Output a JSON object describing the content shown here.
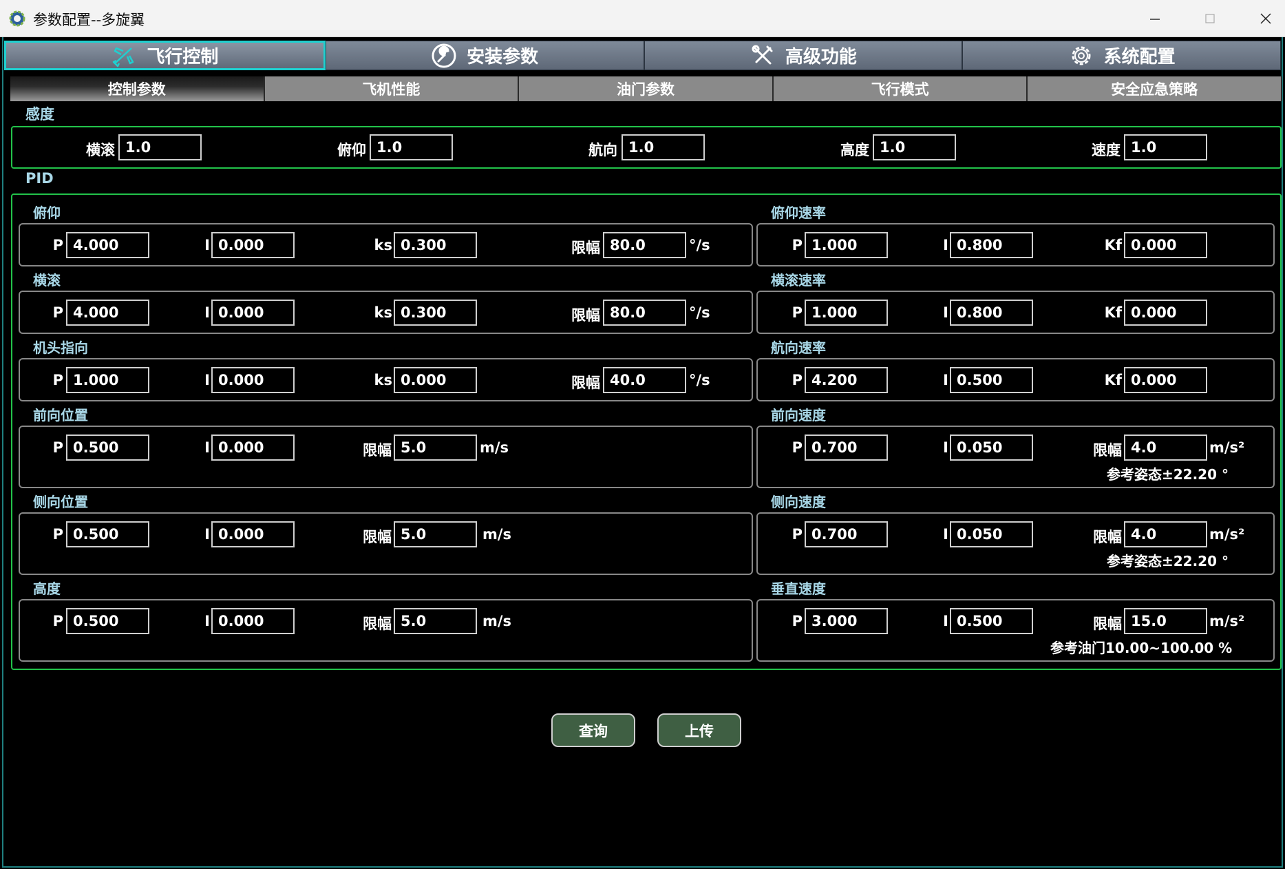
{
  "window": {
    "title": "参数配置--多旋翼"
  },
  "main_tabs": [
    {
      "label": "飞行控制",
      "icon": "airplane-icon"
    },
    {
      "label": "安装参数",
      "icon": "wrench-circle-icon"
    },
    {
      "label": "高级功能",
      "icon": "tools-icon"
    },
    {
      "label": "系统配置",
      "icon": "gear-icon"
    }
  ],
  "sub_tabs": [
    "控制参数",
    "飞机性能",
    "油门参数",
    "飞行模式",
    "安全应急策略"
  ],
  "sensitivity": {
    "title": "感度",
    "fields": [
      {
        "label": "横滚",
        "value": "1.0"
      },
      {
        "label": "俯仰",
        "value": "1.0"
      },
      {
        "label": "航向",
        "value": "1.0"
      },
      {
        "label": "高度",
        "value": "1.0"
      },
      {
        "label": "速度",
        "value": "1.0"
      }
    ]
  },
  "pid": {
    "title": "PID",
    "left": [
      {
        "title": "俯仰",
        "P": "4.000",
        "I": "0.000",
        "third_label": "ks",
        "third": "0.300",
        "limit_label": "限幅",
        "limit": "80.0",
        "unit": "°/s"
      },
      {
        "title": "横滚",
        "P": "4.000",
        "I": "0.000",
        "third_label": "ks",
        "third": "0.300",
        "limit_label": "限幅",
        "limit": "80.0",
        "unit": "°/s"
      },
      {
        "title": "机头指向",
        "P": "1.000",
        "I": "0.000",
        "third_label": "ks",
        "third": "0.000",
        "limit_label": "限幅",
        "limit": "40.0",
        "unit": "°/s"
      },
      {
        "title": "前向位置",
        "P": "0.500",
        "I": "0.000",
        "limit_label": "限幅",
        "limit": "5.0",
        "unit": "m/s"
      },
      {
        "title": "侧向位置",
        "P": "0.500",
        "I": "0.000",
        "limit_label": "限幅",
        "limit": "5.0",
        "unit": "m/s"
      },
      {
        "title": "高度",
        "P": "0.500",
        "I": "0.000",
        "limit_label": "限幅",
        "limit": "5.0",
        "unit": "m/s"
      }
    ],
    "right": [
      {
        "title": "俯仰速率",
        "P": "1.000",
        "I": "0.800",
        "kf_label": "Kf",
        "kf": "0.000"
      },
      {
        "title": "横滚速率",
        "P": "1.000",
        "I": "0.800",
        "kf_label": "Kf",
        "kf": "0.000"
      },
      {
        "title": "航向速率",
        "P": "4.200",
        "I": "0.500",
        "kf_label": "Kf",
        "kf": "0.000"
      },
      {
        "title": "前向速度",
        "P": "0.700",
        "I": "0.050",
        "limit_label": "限幅",
        "limit": "4.0",
        "unit": "m/s²",
        "note": "参考姿态±22.20 °"
      },
      {
        "title": "侧向速度",
        "P": "0.700",
        "I": "0.050",
        "limit_label": "限幅",
        "limit": "4.0",
        "unit": "m/s²",
        "note": "参考姿态±22.20 °"
      },
      {
        "title": "垂直速度",
        "P": "3.000",
        "I": "0.500",
        "limit_label": "限幅",
        "limit": "15.0",
        "unit": "m/s²",
        "note": "参考油门10.00~100.00 %"
      }
    ],
    "p_label": "P",
    "i_label": "I"
  },
  "buttons": {
    "query": "查询",
    "upload": "上传"
  }
}
